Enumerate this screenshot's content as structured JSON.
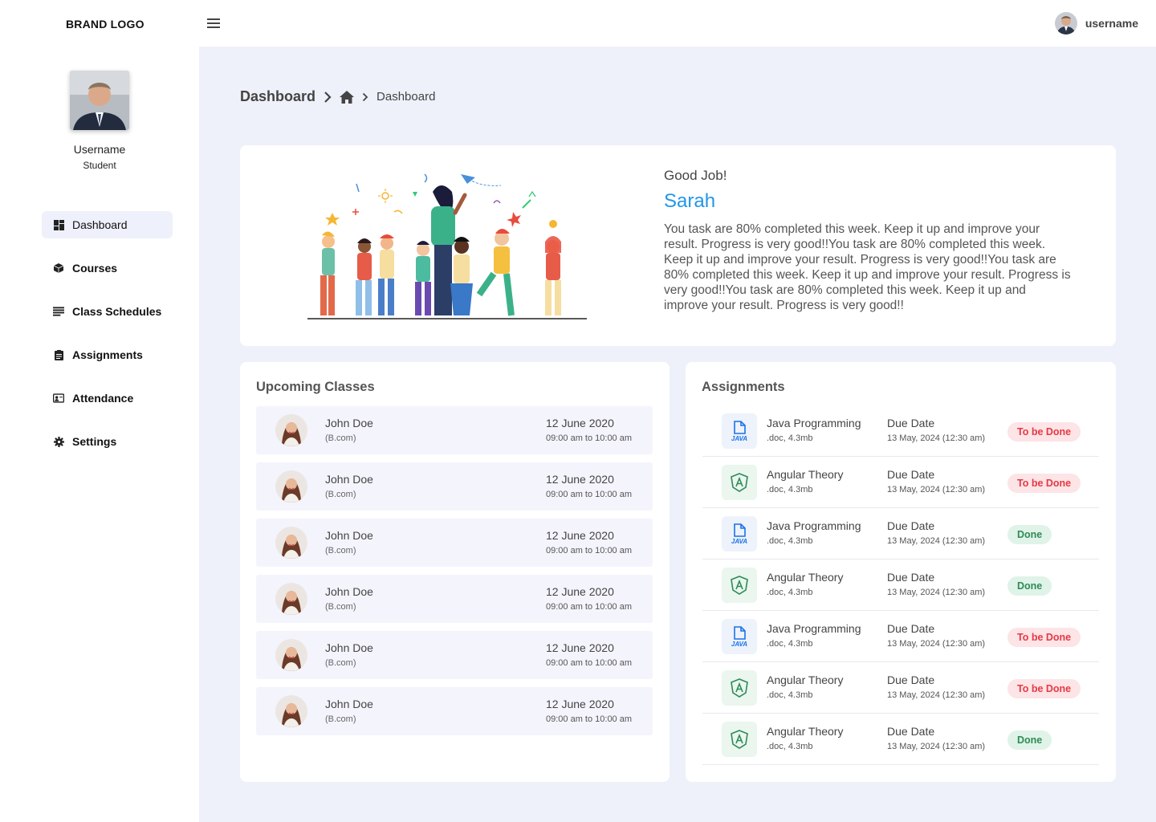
{
  "header": {
    "brand": "BRAND LOGO",
    "username": "username"
  },
  "sidebar": {
    "profile_name": "Username",
    "profile_role": "Student",
    "items": [
      {
        "label": "Dashboard",
        "icon": "dashboard-icon",
        "active": true
      },
      {
        "label": "Courses",
        "icon": "cube-icon"
      },
      {
        "label": "Class Schedules",
        "icon": "list-icon"
      },
      {
        "label": "Assignments",
        "icon": "clipboard-icon"
      },
      {
        "label": "Attendance",
        "icon": "badge-icon"
      },
      {
        "label": "Settings",
        "icon": "gear-icon"
      }
    ]
  },
  "breadcrumb": {
    "title": "Dashboard",
    "current": "Dashboard"
  },
  "hero": {
    "kicker": "Good Job!",
    "name": "Sarah",
    "text": "You task are 80% completed this week. Keep it up and improve your result. Progress is very good!!You task are 80% completed this week. Keep it up and improve your result. Progress is very good!!You task are 80% completed this week. Keep it up and improve your result. Progress is very good!!You task are 80% completed this week. Keep it up and improve your result. Progress is very good!!"
  },
  "upcoming": {
    "title": "Upcoming Classes",
    "rows": [
      {
        "name": "John Doe",
        "sub": "(B.com)",
        "date": "12 June 2020",
        "time": "09:00 am to 10:00 am"
      },
      {
        "name": "John Doe",
        "sub": "(B.com)",
        "date": "12 June 2020",
        "time": "09:00 am to 10:00 am"
      },
      {
        "name": "John Doe",
        "sub": "(B.com)",
        "date": "12 June 2020",
        "time": "09:00 am to 10:00 am"
      },
      {
        "name": "John Doe",
        "sub": "(B.com)",
        "date": "12 June 2020",
        "time": "09:00 am to 10:00 am"
      },
      {
        "name": "John Doe",
        "sub": "(B.com)",
        "date": "12 June 2020",
        "time": "09:00 am to 10:00 am"
      },
      {
        "name": "John Doe",
        "sub": "(B.com)",
        "date": "12 June 2020",
        "time": "09:00 am to 10:00 am"
      }
    ]
  },
  "assignments": {
    "title": "Assignments",
    "rows": [
      {
        "type": "java",
        "name": "Java Programming",
        "meta": ".doc, 4.3mb",
        "due_label": "Due Date",
        "due": "13 May, 2024 (12:30 am)",
        "status": "To be Done",
        "state": "todo"
      },
      {
        "type": "angular",
        "name": "Angular Theory",
        "meta": ".doc, 4.3mb",
        "due_label": "Due Date",
        "due": "13 May, 2024 (12:30 am)",
        "status": "To be Done",
        "state": "todo"
      },
      {
        "type": "java",
        "name": "Java Programming",
        "meta": ".doc, 4.3mb",
        "due_label": "Due Date",
        "due": "13 May, 2024 (12:30 am)",
        "status": "Done",
        "state": "done"
      },
      {
        "type": "angular",
        "name": "Angular Theory",
        "meta": ".doc, 4.3mb",
        "due_label": "Due Date",
        "due": "13 May, 2024 (12:30 am)",
        "status": "Done",
        "state": "done"
      },
      {
        "type": "java",
        "name": "Java Programming",
        "meta": ".doc, 4.3mb",
        "due_label": "Due Date",
        "due": "13 May, 2024 (12:30 am)",
        "status": "To be Done",
        "state": "todo"
      },
      {
        "type": "angular",
        "name": "Angular Theory",
        "meta": ".doc, 4.3mb",
        "due_label": "Due Date",
        "due": "13 May, 2024 (12:30 am)",
        "status": "To be Done",
        "state": "todo"
      },
      {
        "type": "angular",
        "name": "Angular Theory",
        "meta": ".doc, 4.3mb",
        "due_label": "Due Date",
        "due": "13 May, 2024 (12:30 am)",
        "status": "Done",
        "state": "done"
      }
    ]
  },
  "colors": {
    "accent": "#2196e8",
    "todo": "#e53946",
    "done": "#2e8b57",
    "background": "#eef1f9"
  }
}
